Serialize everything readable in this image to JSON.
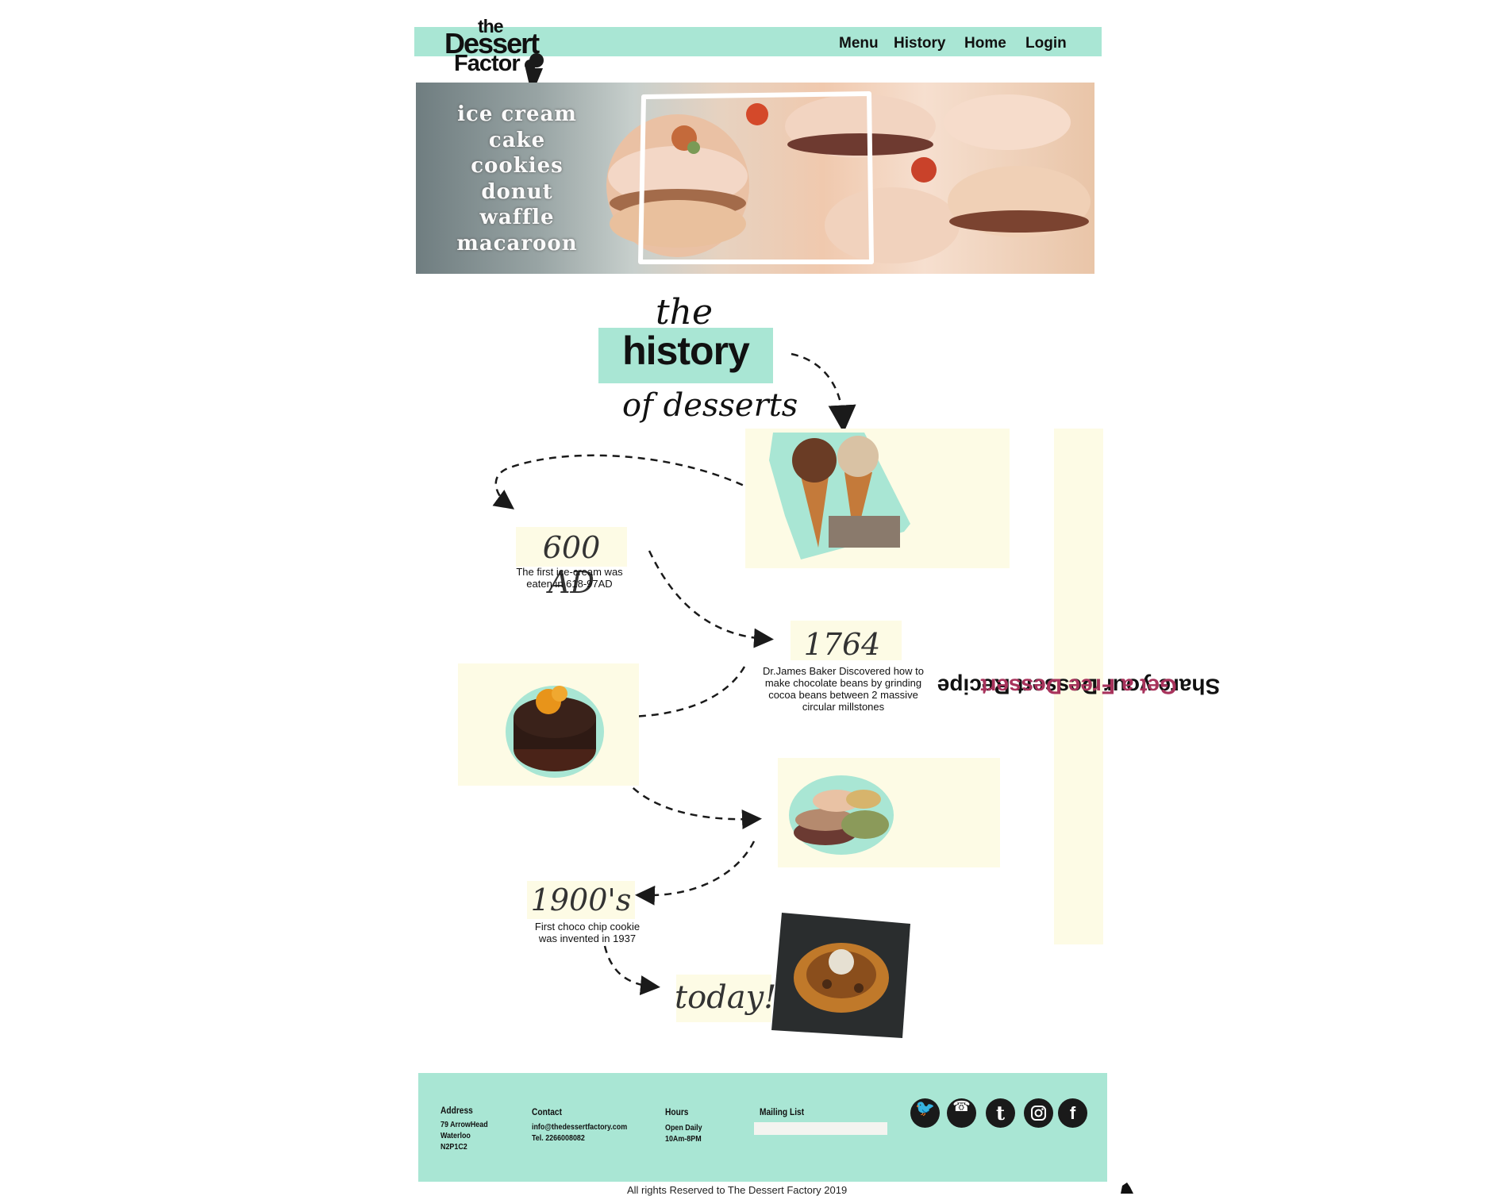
{
  "logo": {
    "the": "the",
    "dessert": "Dessert",
    "factor": "Factor"
  },
  "nav": {
    "items": [
      "Menu",
      "History",
      "Home",
      "Login"
    ]
  },
  "hero": {
    "items": [
      "ice cream",
      "cake",
      "cookies",
      "donut",
      "waffle",
      "macaroon"
    ]
  },
  "title": {
    "the": "the",
    "history": "history",
    "of": "of desserts"
  },
  "timeline": [
    {
      "year": "600 AD",
      "text": "The first ice-cream was eaten in 618-97AD"
    },
    {
      "year": "1764",
      "text": "Dr.James Baker Discovered how to make chocolate beans by grinding cocoa beans between 2  massive circular millstones"
    },
    {
      "year": "1900's",
      "text": "First choco chip cookie was invented in 1937"
    },
    {
      "year": "today!!!"
    }
  ],
  "side_banner": {
    "share": "Share your Dessert Recipe",
    "free": "Get a Free Dessert"
  },
  "footer": {
    "address": {
      "heading": "Address",
      "lines": [
        "79 ArrowHead",
        "Waterloo",
        "N2P1C2"
      ]
    },
    "contact": {
      "heading": "Contact",
      "lines": [
        "info@thedessertfactory.com",
        "Tel. 2266008082"
      ]
    },
    "hours": {
      "heading": "Hours",
      "lines": [
        "Open Daily",
        "10Am-8PM"
      ]
    },
    "mailing": {
      "heading": "Mailing List"
    },
    "social": [
      "twitter-icon",
      "whatsapp-icon",
      "tumblr-icon",
      "instagram-icon",
      "facebook-icon"
    ],
    "copyright": "All rights Reserved to The Dessert Factory 2019"
  },
  "colors": {
    "accent": "#a9e6d4",
    "cream": "#fdfbe5",
    "banner_red": "#a8335c"
  }
}
